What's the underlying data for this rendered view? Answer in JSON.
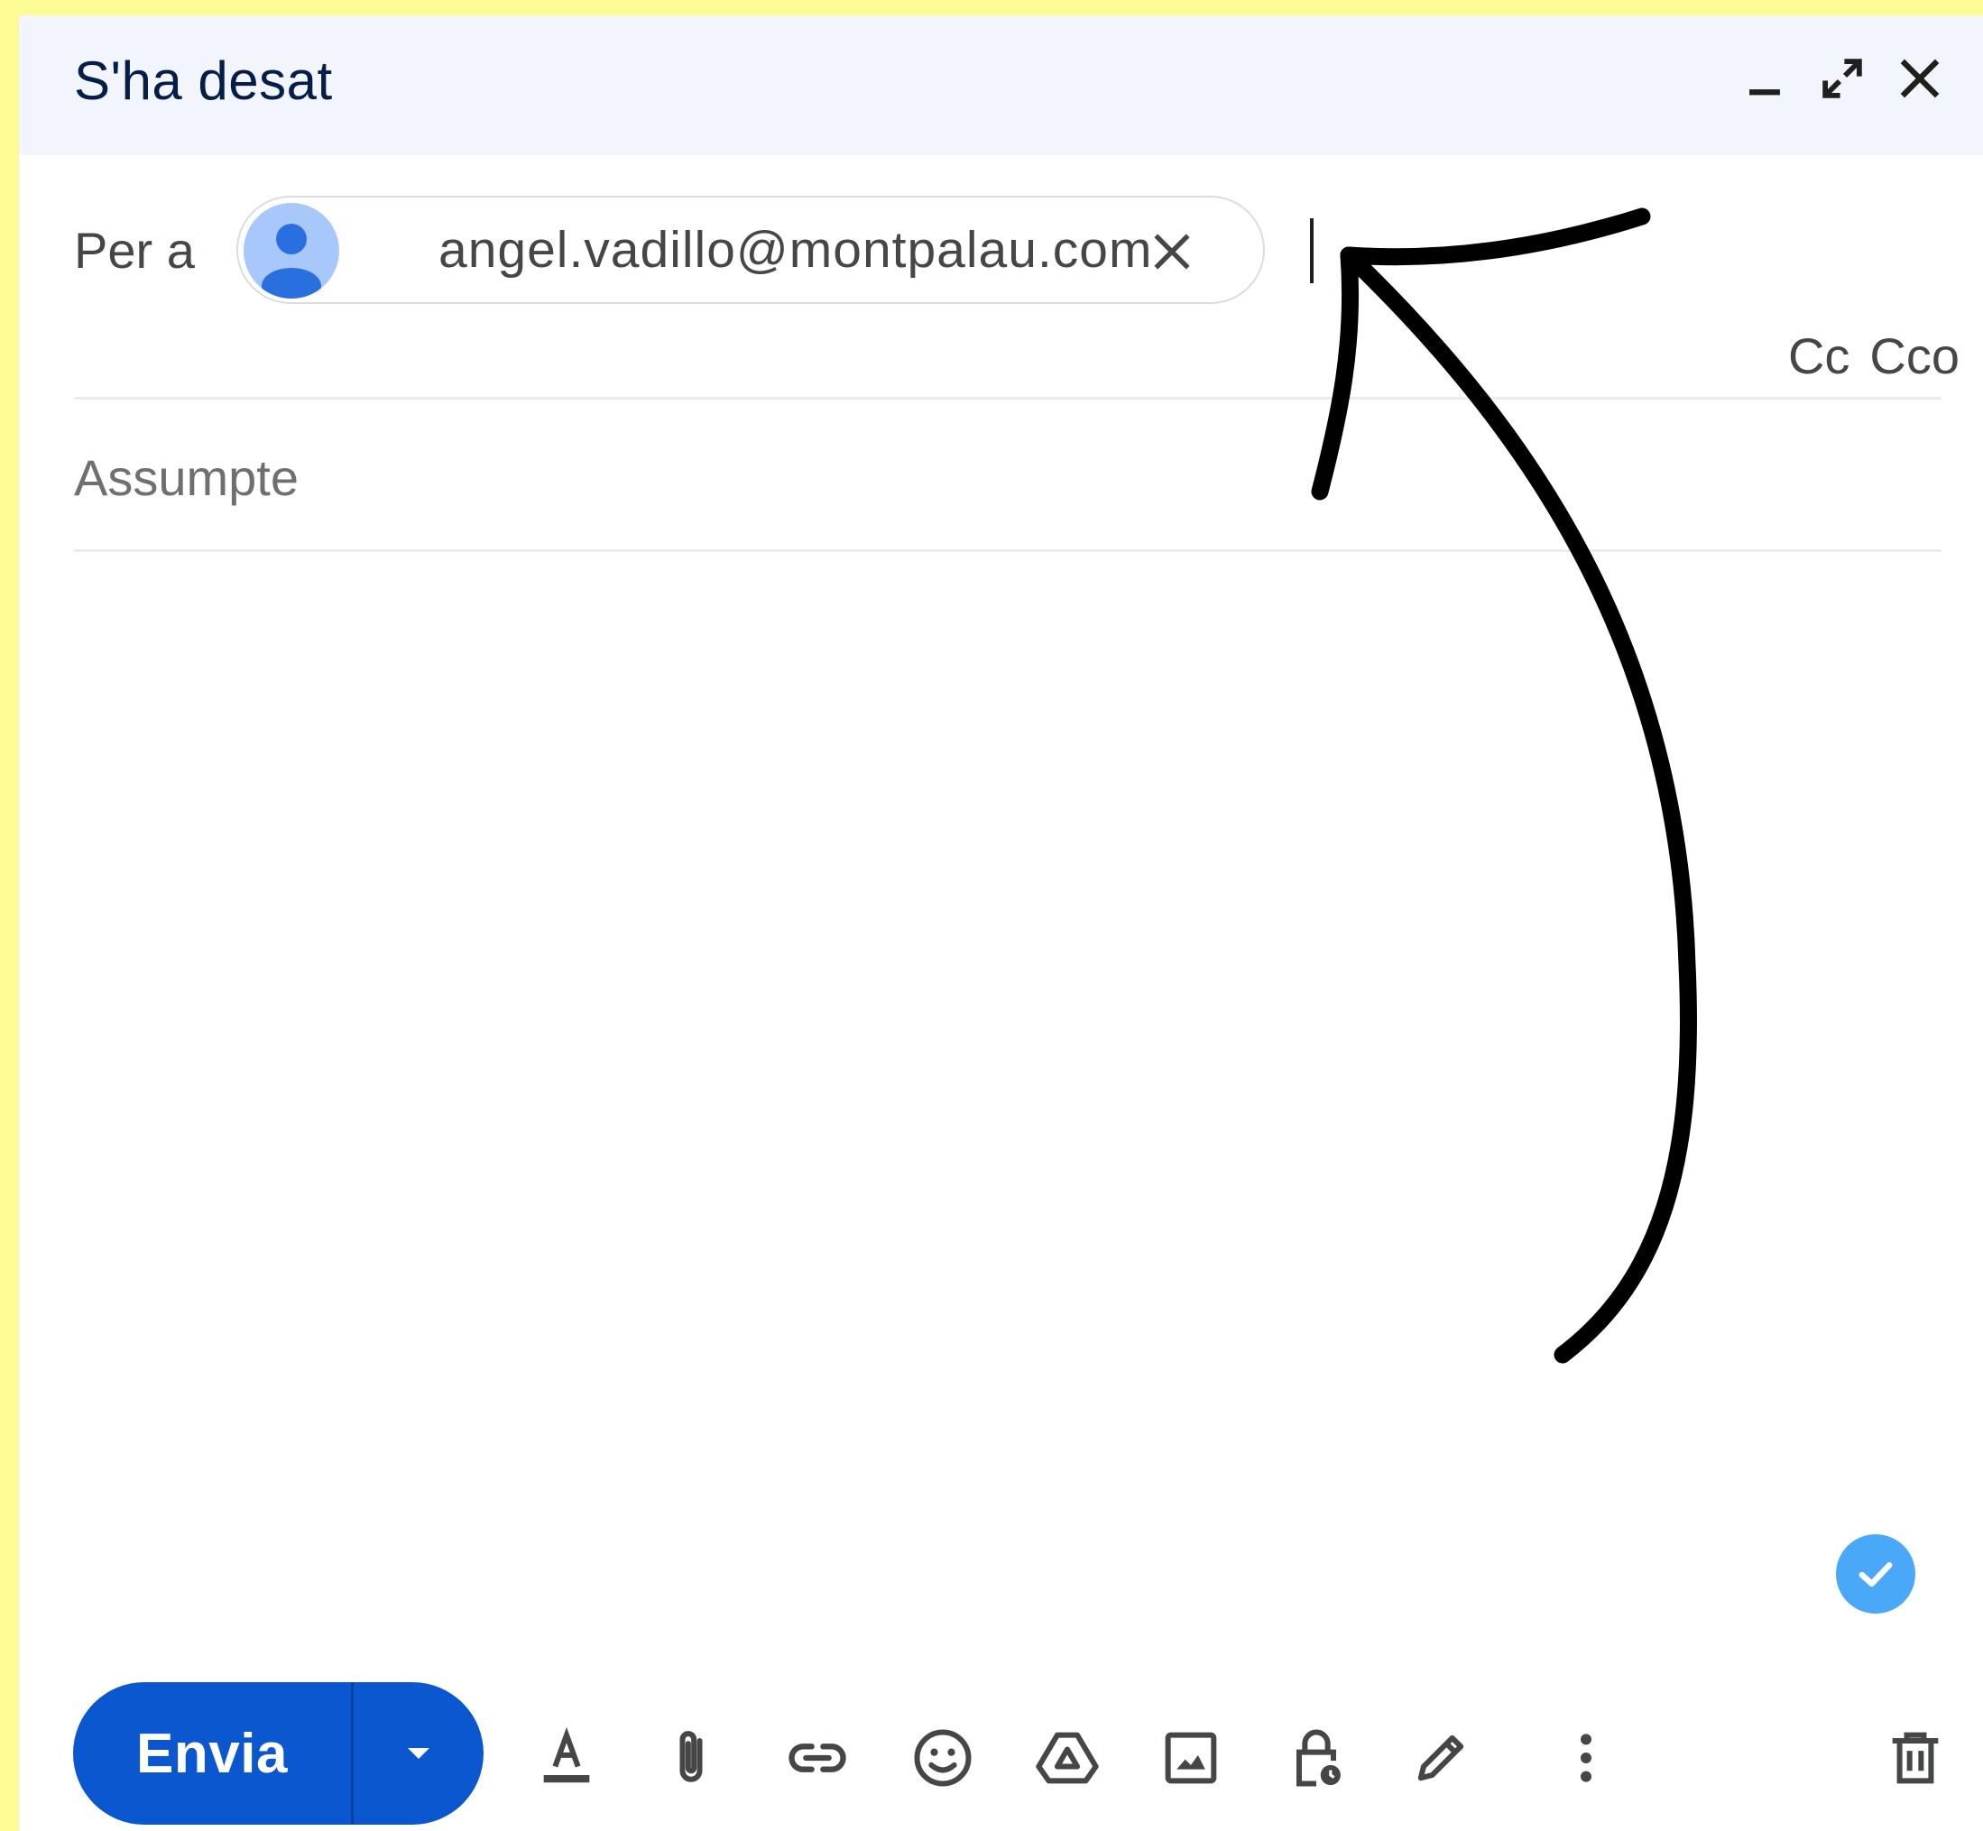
{
  "window": {
    "title": "S'ha desat",
    "minimize_icon": "minimize-icon",
    "fullscreen_icon": "open-in-full-icon",
    "close_icon": "close-icon"
  },
  "recipients": {
    "to_label": "Per a",
    "chips": [
      {
        "email": "angel.vadillo@montpalau.com",
        "avatar_icon": "person-avatar-icon",
        "remove_icon": "close-icon"
      }
    ],
    "cc_label": "Cc",
    "bcc_label": "Cco"
  },
  "subject": {
    "placeholder": "Assumpte",
    "value": ""
  },
  "body": {
    "value": ""
  },
  "status": {
    "check_icon": "check-circle-icon"
  },
  "footer": {
    "send_label": "Envia",
    "send_options_icon": "arrow-drop-down-icon",
    "tools": [
      "text-format-icon",
      "attach-file-icon",
      "insert-link-icon",
      "emoji-icon",
      "google-drive-icon",
      "insert-photo-icon",
      "confidential-mode-icon",
      "signature-pen-icon",
      "more-options-icon"
    ],
    "discard_icon": "delete-icon"
  },
  "colors": {
    "background": "#fdfb94",
    "header_bg": "#f2f6fc",
    "send_button": "#0b57d0",
    "check_badge": "#4aa8f8",
    "avatar": "#a8c7fa"
  }
}
